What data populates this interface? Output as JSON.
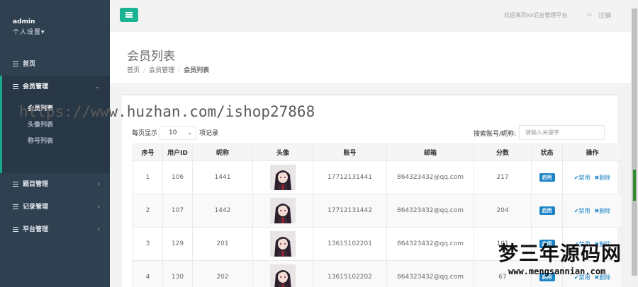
{
  "sidebar": {
    "user": "admin",
    "settings": "个人设置▾",
    "items": [
      {
        "label": "首页",
        "caret": ""
      },
      {
        "label": "会员管理",
        "caret": "⌄"
      },
      {
        "label": "题目管理",
        "caret": "‹"
      },
      {
        "label": "记录管理",
        "caret": "‹"
      },
      {
        "label": "平台管理",
        "caret": "‹"
      }
    ],
    "submenu": [
      "会员列表",
      "头像列表",
      "称号列表"
    ]
  },
  "topbar": {
    "welcome": "欢迎来到xx后台管理平台",
    "logout_icon": "⇨",
    "logout": "注销"
  },
  "heading": {
    "title": "会员列表",
    "crumbs": [
      "首页",
      "会员管理",
      "会员列表"
    ]
  },
  "overlay": {
    "watermark_top": "https://www.huzhan.com/ishop27868",
    "watermark_cn": "梦三年源码网",
    "watermark_en": "www.mengsannian.com"
  },
  "controls": {
    "page_size_prefix": "每页显示",
    "page_size_value": "10",
    "page_size_suffix": "项记录",
    "search_label": "搜索账号/昵称:",
    "search_placeholder": "请输入关键字"
  },
  "table": {
    "headers": [
      "序号",
      "用户ID",
      "昵称",
      "头像",
      "账号",
      "邮箱",
      "分数",
      "状态",
      "操作"
    ],
    "rows": [
      {
        "no": "1",
        "uid": "106",
        "nick": "1441",
        "account": "17712131441",
        "email": "864323432@qq.com",
        "score": "217",
        "status": "启用",
        "op1": "禁用",
        "op2": "删除"
      },
      {
        "no": "2",
        "uid": "107",
        "nick": "1442",
        "account": "17712131442",
        "email": "864323432@qq.com",
        "score": "204",
        "status": "启用",
        "op1": "禁用",
        "op2": "删除"
      },
      {
        "no": "3",
        "uid": "129",
        "nick": "201",
        "account": "13615102201",
        "email": "864323432@qq.com",
        "score": "101",
        "status": "启用",
        "op1": "禁用",
        "op2": "删除"
      },
      {
        "no": "4",
        "uid": "130",
        "nick": "202",
        "account": "13615102202",
        "email": "864323432@qq.com",
        "score": "67",
        "status": "启用",
        "op1": "禁用",
        "op2": "删除"
      }
    ]
  },
  "colors": {
    "sidebar_bg": "#2f4050",
    "accent_green": "#1ab394",
    "badge_blue": "#1c84c6"
  }
}
